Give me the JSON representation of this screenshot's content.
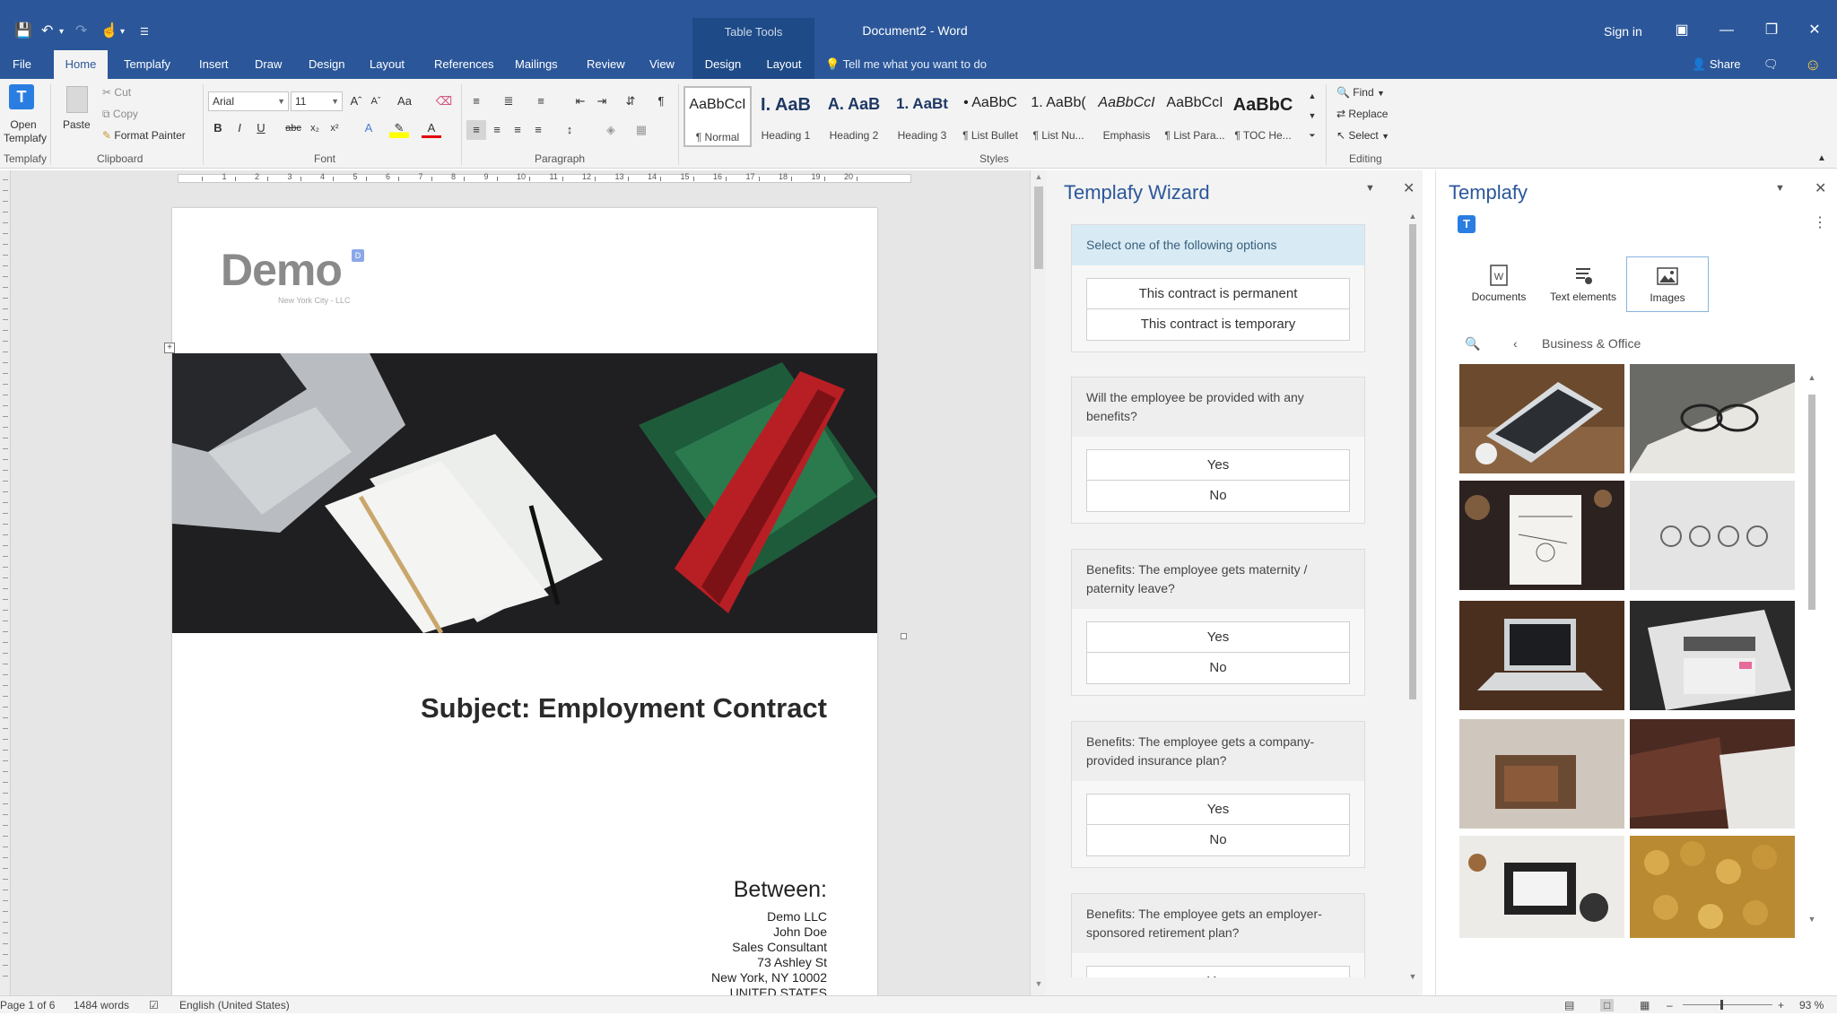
{
  "window": {
    "title": "Document2 - Word",
    "context_tab_group": "Table Tools",
    "sign_in": "Sign in"
  },
  "ribbon_tabs": [
    {
      "label": "File"
    },
    {
      "label": "Home"
    },
    {
      "label": "Templafy"
    },
    {
      "label": "Insert"
    },
    {
      "label": "Draw"
    },
    {
      "label": "Design"
    },
    {
      "label": "Layout"
    },
    {
      "label": "References"
    },
    {
      "label": "Mailings"
    },
    {
      "label": "Review"
    },
    {
      "label": "View"
    },
    {
      "label": "Design"
    },
    {
      "label": "Layout"
    }
  ],
  "tell_me": "Tell me what you want to do",
  "share": "Share",
  "ribbon": {
    "templafy_group": {
      "button": "Open\nTemplafy",
      "label": "Templafy"
    },
    "clipboard": {
      "paste": "Paste",
      "cut": "Cut",
      "copy": "Copy",
      "format_painter": "Format Painter",
      "label": "Clipboard"
    },
    "font": {
      "name": "Arial",
      "size": "11",
      "label": "Font"
    },
    "paragraph": {
      "label": "Paragraph"
    },
    "styles": {
      "label": "Styles",
      "items": [
        {
          "sample": "AaBbCcI",
          "name": "¶ Normal"
        },
        {
          "sample": "I. AaB",
          "name": "Heading 1"
        },
        {
          "sample": "A. AaB",
          "name": "Heading 2"
        },
        {
          "sample": "1. AaBt",
          "name": "Heading 3"
        },
        {
          "sample": "• AaBbC",
          "name": "¶ List Bullet"
        },
        {
          "sample": "1. AaBb(",
          "name": "¶ List Nu..."
        },
        {
          "sample": "AaBbCcI",
          "name": "Emphasis"
        },
        {
          "sample": "AaBbCcI",
          "name": "¶ List Para..."
        },
        {
          "sample": "AaBbC",
          "name": "¶ TOC He..."
        }
      ]
    },
    "editing": {
      "find": "Find",
      "replace": "Replace",
      "select": "Select",
      "label": "Editing"
    }
  },
  "document": {
    "logo_text": "Demo",
    "logo_badge": "D",
    "logo_sub": "New York City - LLC",
    "subject": "Subject: Employment Contract",
    "between": "Between:",
    "address_lines": [
      "Demo LLC",
      "John Doe",
      "Sales Consultant",
      "73 Ashley St",
      "New York, NY 10002",
      "UNITED STATES"
    ]
  },
  "wizard": {
    "title": "Templafy Wizard",
    "cards": [
      {
        "question": "Select one of the following options",
        "options": [
          "This contract is permanent",
          "This contract is temporary"
        ]
      },
      {
        "question": "Will the employee be provided with any benefits?",
        "options": [
          "Yes",
          "No"
        ]
      },
      {
        "question": "Benefits: The employee gets maternity / paternity leave?",
        "options": [
          "Yes",
          "No"
        ]
      },
      {
        "question": "Benefits: The employee gets a company-provided insurance plan?",
        "options": [
          "Yes",
          "No"
        ]
      },
      {
        "question": "Benefits: The employee gets an employer-sponsored retirement plan?",
        "options": [
          "Yes"
        ]
      }
    ]
  },
  "templafy": {
    "title": "Templafy",
    "logo": "T",
    "tabs": [
      {
        "label": "Documents"
      },
      {
        "label": "Text elements"
      },
      {
        "label": "Images"
      }
    ],
    "active_tab": "Images",
    "breadcrumb": "Business & Office"
  },
  "status": {
    "page": "Page 1 of 6",
    "words": "1484 words",
    "language": "English (United States)",
    "zoom": "93 %"
  },
  "colors": {
    "accent": "#2b579a",
    "wizard_title": "#2b579a",
    "selected_option_bg": "#d8ebf5"
  }
}
